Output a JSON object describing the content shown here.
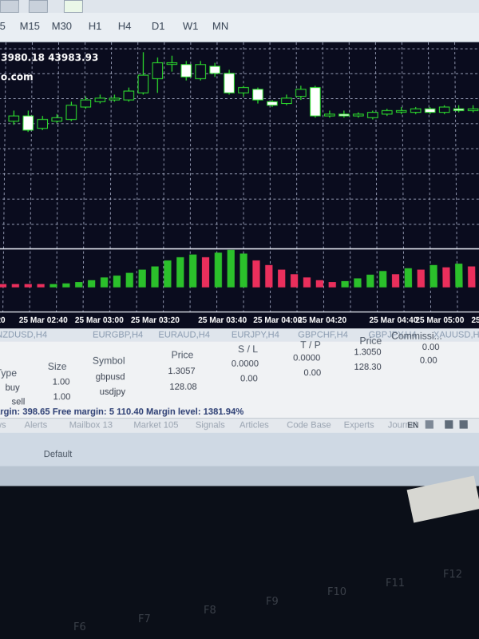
{
  "toolbar": {
    "timeframes": [
      "5",
      "M15",
      "M30",
      "H1",
      "H4",
      "D1",
      "W1",
      "MN"
    ]
  },
  "chart": {
    "price_line": "3980.18 43983.93",
    "site_fragment": "o.com",
    "time_labels": [
      "20",
      "25 Mar 02:40",
      "25 Mar 03:00",
      "25 Mar 03:20",
      "25 Mar 03:40",
      "25 Mar 04:00",
      "25 Mar 04:20",
      "25 Mar 04:40",
      "25 Mar 05:00",
      "25"
    ]
  },
  "chart_tabs": [
    "NZDUSD,H4",
    "EURGBP,H4",
    "EURAUD,H4",
    "EURJPY,H4",
    "GBPCHF,H4",
    "GBPJPY,H4",
    "XAUUSD,H4"
  ],
  "terminal": {
    "headers": {
      "type": "Type",
      "size": "Size",
      "symbol": "Symbol",
      "price": "Price",
      "sl": "S / L",
      "tp": "T / P",
      "price2": "Price",
      "commission": "Commissi..."
    },
    "rows": [
      {
        "type": "buy",
        "size": "1.00",
        "symbol": "gbpusd",
        "price": "1.3057",
        "sl": "0.0000",
        "tp": "0.0000",
        "price2": "1.3050",
        "commission": "0.00"
      },
      {
        "type": "sell",
        "size": "1.00",
        "symbol": "usdjpy",
        "price": "128.08",
        "sl": "0.00",
        "tp": "0.00",
        "price2": "128.30",
        "commission": "0.00"
      }
    ],
    "margin_line": "argin: 398.65  Free margin: 5 110.40  Margin level: 1381.94%"
  },
  "bottom_tabs": [
    "ws",
    "Alerts",
    "Mailbox 13",
    "Market 105",
    "Signals",
    "Articles",
    "Code Base",
    "Experts",
    "Journal"
  ],
  "taskbar": {
    "lang": "EN",
    "default_label": "Default"
  },
  "keyboard": {
    "keys": [
      "F6",
      "F7",
      "F8",
      "F9",
      "F10",
      "F11",
      "F12"
    ]
  },
  "candles": [
    {
      "o": 0.6,
      "c": 0.63,
      "h": 0.66,
      "l": 0.58,
      "bull": true
    },
    {
      "o": 0.63,
      "c": 0.55,
      "h": 0.66,
      "l": 0.54,
      "bull": false
    },
    {
      "o": 0.56,
      "c": 0.61,
      "h": 0.63,
      "l": 0.55,
      "bull": true
    },
    {
      "o": 0.6,
      "c": 0.62,
      "h": 0.64,
      "l": 0.59,
      "bull": true
    },
    {
      "o": 0.61,
      "c": 0.69,
      "h": 0.71,
      "l": 0.6,
      "bull": true
    },
    {
      "o": 0.68,
      "c": 0.72,
      "h": 0.74,
      "l": 0.67,
      "bull": true
    },
    {
      "o": 0.71,
      "c": 0.73,
      "h": 0.75,
      "l": 0.7,
      "bull": true
    },
    {
      "o": 0.72,
      "c": 0.73,
      "h": 0.75,
      "l": 0.71,
      "bull": true
    },
    {
      "o": 0.72,
      "c": 0.77,
      "h": 0.79,
      "l": 0.71,
      "bull": true
    },
    {
      "o": 0.76,
      "c": 0.86,
      "h": 0.99,
      "l": 0.75,
      "bull": true
    },
    {
      "o": 0.84,
      "c": 0.93,
      "h": 0.96,
      "l": 0.76,
      "bull": true
    },
    {
      "o": 0.93,
      "c": 0.93,
      "h": 0.97,
      "l": 0.88,
      "bull": true
    },
    {
      "o": 0.92,
      "c": 0.85,
      "h": 0.94,
      "l": 0.83,
      "bull": false
    },
    {
      "o": 0.84,
      "c": 0.92,
      "h": 0.94,
      "l": 0.83,
      "bull": true
    },
    {
      "o": 0.91,
      "c": 0.87,
      "h": 0.93,
      "l": 0.85,
      "bull": false
    },
    {
      "o": 0.87,
      "c": 0.76,
      "h": 0.89,
      "l": 0.75,
      "bull": false
    },
    {
      "o": 0.76,
      "c": 0.79,
      "h": 0.8,
      "l": 0.74,
      "bull": true
    },
    {
      "o": 0.78,
      "c": 0.72,
      "h": 0.79,
      "l": 0.7,
      "bull": false
    },
    {
      "o": 0.71,
      "c": 0.69,
      "h": 0.72,
      "l": 0.68,
      "bull": false
    },
    {
      "o": 0.7,
      "c": 0.73,
      "h": 0.75,
      "l": 0.69,
      "bull": true
    },
    {
      "o": 0.74,
      "c": 0.78,
      "h": 0.8,
      "l": 0.72,
      "bull": true
    },
    {
      "o": 0.79,
      "c": 0.63,
      "h": 0.8,
      "l": 0.62,
      "bull": false
    },
    {
      "o": 0.63,
      "c": 0.64,
      "h": 0.66,
      "l": 0.62,
      "bull": true
    },
    {
      "o": 0.64,
      "c": 0.63,
      "h": 0.66,
      "l": 0.62,
      "bull": false
    },
    {
      "o": 0.63,
      "c": 0.64,
      "h": 0.65,
      "l": 0.62,
      "bull": true
    },
    {
      "o": 0.62,
      "c": 0.65,
      "h": 0.66,
      "l": 0.61,
      "bull": true
    },
    {
      "o": 0.64,
      "c": 0.66,
      "h": 0.67,
      "l": 0.63,
      "bull": true
    },
    {
      "o": 0.66,
      "c": 0.66,
      "h": 0.68,
      "l": 0.64,
      "bull": true
    },
    {
      "o": 0.65,
      "c": 0.67,
      "h": 0.68,
      "l": 0.64,
      "bull": true
    },
    {
      "o": 0.67,
      "c": 0.65,
      "h": 0.68,
      "l": 0.64,
      "bull": false
    },
    {
      "o": 0.65,
      "c": 0.68,
      "h": 0.69,
      "l": 0.64,
      "bull": true
    },
    {
      "o": 0.67,
      "c": 0.66,
      "h": 0.69,
      "l": 0.65,
      "bull": false
    },
    {
      "o": 0.66,
      "c": 0.67,
      "h": 0.69,
      "l": 0.65,
      "bull": true
    }
  ],
  "histogram": [
    {
      "v": -0.1,
      "c": "red"
    },
    {
      "v": -0.05,
      "c": "red"
    },
    {
      "v": -0.06,
      "c": "red"
    },
    {
      "v": -0.04,
      "c": "red"
    },
    {
      "v": 0.03,
      "c": "green"
    },
    {
      "v": 0.05,
      "c": "green"
    },
    {
      "v": 0.08,
      "c": "green"
    },
    {
      "v": 0.12,
      "c": "green"
    },
    {
      "v": 0.18,
      "c": "green"
    },
    {
      "v": 0.22,
      "c": "green"
    },
    {
      "v": 0.28,
      "c": "green"
    },
    {
      "v": 0.35,
      "c": "green"
    },
    {
      "v": 0.42,
      "c": "green"
    },
    {
      "v": 0.55,
      "c": "green"
    },
    {
      "v": 0.62,
      "c": "green"
    },
    {
      "v": 0.68,
      "c": "green"
    },
    {
      "v": 0.62,
      "c": "red"
    },
    {
      "v": 0.72,
      "c": "green"
    },
    {
      "v": 0.78,
      "c": "green"
    },
    {
      "v": 0.7,
      "c": "green"
    },
    {
      "v": 0.55,
      "c": "red"
    },
    {
      "v": 0.45,
      "c": "red"
    },
    {
      "v": 0.35,
      "c": "red"
    },
    {
      "v": 0.25,
      "c": "red"
    },
    {
      "v": 0.18,
      "c": "red"
    },
    {
      "v": 0.12,
      "c": "red"
    },
    {
      "v": 0.08,
      "c": "red"
    },
    {
      "v": 0.1,
      "c": "green"
    },
    {
      "v": 0.16,
      "c": "green"
    },
    {
      "v": 0.24,
      "c": "green"
    },
    {
      "v": 0.32,
      "c": "green"
    },
    {
      "v": 0.25,
      "c": "red"
    },
    {
      "v": 0.38,
      "c": "green"
    },
    {
      "v": 0.35,
      "c": "red"
    },
    {
      "v": 0.45,
      "c": "green"
    },
    {
      "v": 0.4,
      "c": "red"
    },
    {
      "v": 0.48,
      "c": "green"
    },
    {
      "v": 0.42,
      "c": "red"
    }
  ]
}
